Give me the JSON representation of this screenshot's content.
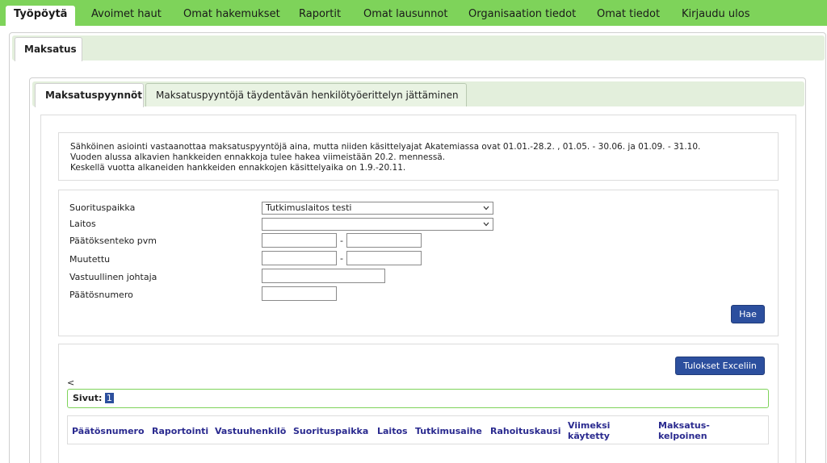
{
  "nav": {
    "items": [
      {
        "label": "Työpöytä",
        "active": true
      },
      {
        "label": "Avoimet haut"
      },
      {
        "label": "Omat hakemukset"
      },
      {
        "label": "Raportit"
      },
      {
        "label": "Omat lausunnot"
      },
      {
        "label": "Organisaation tiedot"
      },
      {
        "label": "Omat tiedot"
      },
      {
        "label": "Kirjaudu ulos"
      }
    ]
  },
  "outer_tab": {
    "label": "Maksatus"
  },
  "inner_tabs": [
    {
      "label": "Maksatuspyynnöt",
      "active": true
    },
    {
      "label": "Maksatuspyyntöjä täydentävän henkilötyöerittelyn jättäminen"
    }
  ],
  "notice": {
    "lines": [
      "Sähköinen asiointi vastaanottaa maksatuspyyntöjä aina, mutta niiden käsittelyajat Akatemiassa ovat 01.01.-28.2. , 01.05. - 30.06. ja 01.09. - 31.10.",
      "Vuoden alussa alkavien hankkeiden ennakkoja tulee hakea viimeistään 20.2. mennessä.",
      "Keskellä vuotta alkaneiden hankkeiden ennakkojen käsittelyaika on 1.9.-20.11."
    ]
  },
  "form": {
    "suorituspaikka_label": "Suorituspaikka",
    "suorituspaikka_value": "Tutkimuslaitos testi",
    "laitos_label": "Laitos",
    "laitos_value": "",
    "paatoksenteko_label": "Päätöksenteko pvm",
    "paatoksenteko_from": "",
    "paatoksenteko_to": "",
    "muutettu_label": "Muutettu",
    "muutettu_from": "",
    "muutettu_to": "",
    "date_separator": "-",
    "johtaja_label": "Vastuullinen johtaja",
    "johtaja_value": "",
    "paatosnumero_label": "Päätösnumero",
    "paatosnumero_value": "",
    "search_button": "Hae"
  },
  "results": {
    "excel_button": "Tulokset Exceliin",
    "prev_link": "<",
    "pager_label": "Sivut:",
    "current_page": "1",
    "columns": [
      "Päätösnumero",
      "Raportointi",
      "Vastuuhenkilö",
      "Suorituspaikka",
      "Laitos",
      "Tutkimusaihe",
      "Rahoituskausi",
      "Viimeksi käytetty",
      "Maksatus-kelpoinen"
    ],
    "col_viimeksi_line1": "Viimeksi",
    "col_viimeksi_line2": "käytetty",
    "col_maksatus_line1": "Maksatus-",
    "col_maksatus_line2": "kelpoinen"
  },
  "colors": {
    "nav_green": "#7ed35a",
    "tabbar_green": "#e3efdc",
    "button_blue": "#2c4f9e",
    "header_link": "#2a2a8f"
  }
}
